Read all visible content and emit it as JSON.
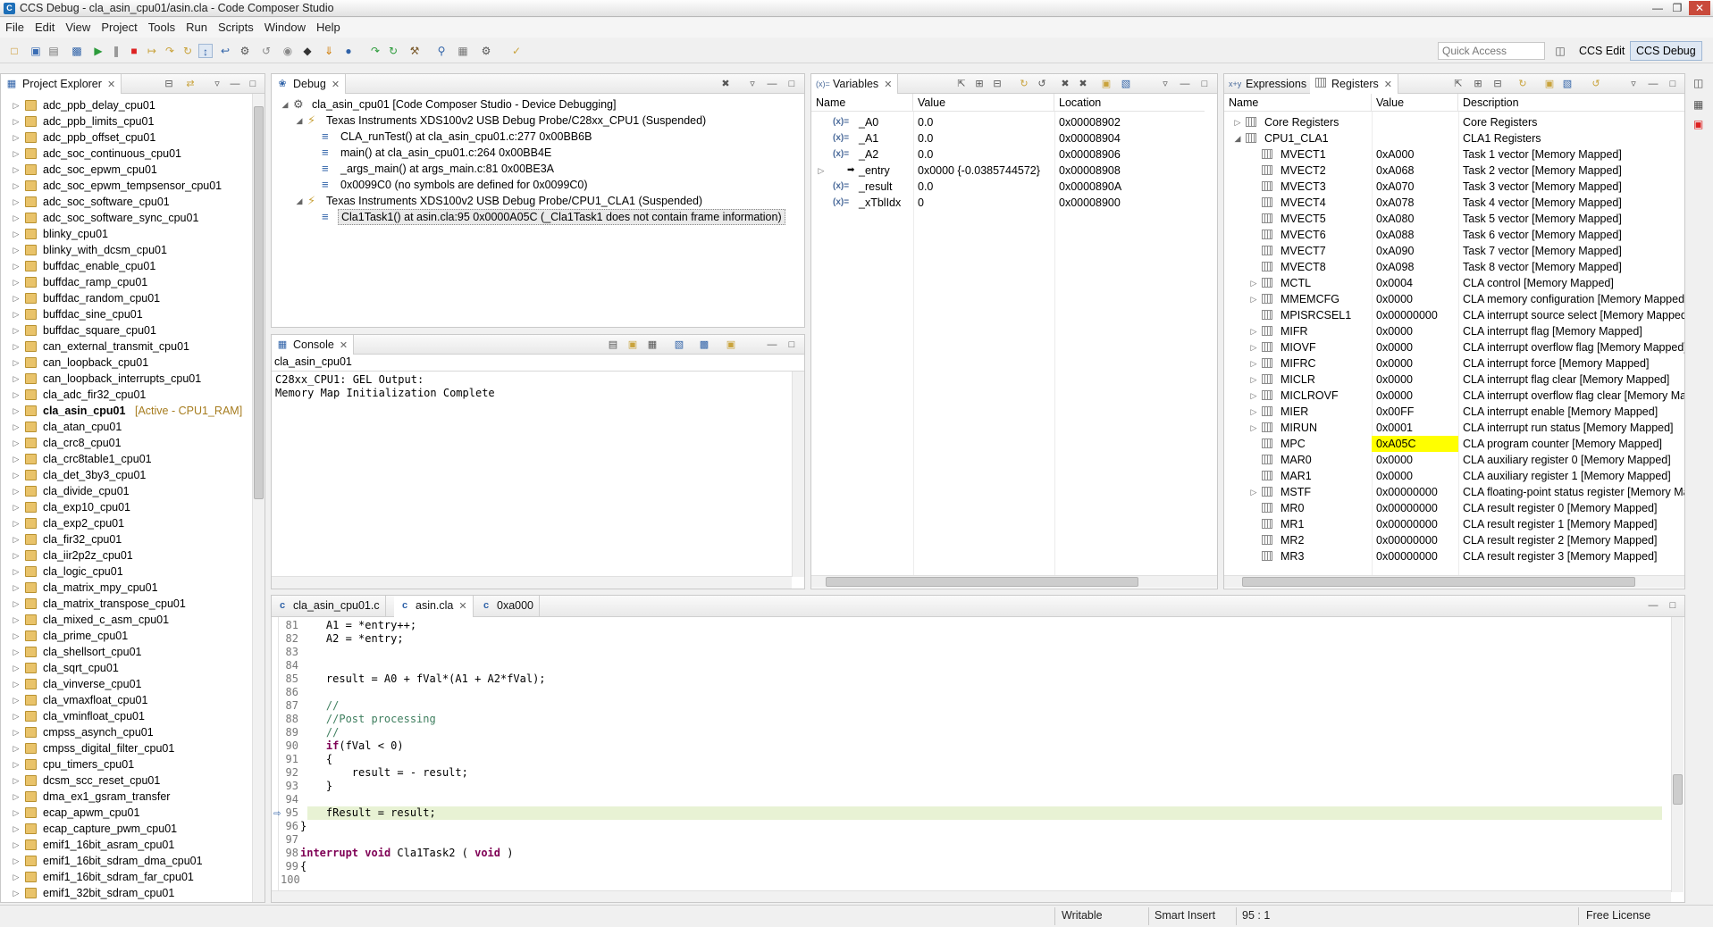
{
  "window": {
    "title": "CCS Debug - cla_asin_cpu01/asin.cla - Code Composer Studio"
  },
  "menu": [
    "File",
    "Edit",
    "View",
    "Project",
    "Tools",
    "Run",
    "Scripts",
    "Window",
    "Help"
  ],
  "toolbar": {
    "quick_access_placeholder": "Quick Access",
    "perspective_edit": "CCS Edit",
    "perspective_debug": "CCS Debug"
  },
  "project_explorer": {
    "title": "Project Explorer",
    "active_suffix": "[Active - CPU1_RAM]",
    "projects": [
      "adc_ppb_delay_cpu01",
      "adc_ppb_limits_cpu01",
      "adc_ppb_offset_cpu01",
      "adc_soc_continuous_cpu01",
      "adc_soc_epwm_cpu01",
      "adc_soc_epwm_tempsensor_cpu01",
      "adc_soc_software_cpu01",
      "adc_soc_software_sync_cpu01",
      "blinky_cpu01",
      "blinky_with_dcsm_cpu01",
      "buffdac_enable_cpu01",
      "buffdac_ramp_cpu01",
      "buffdac_random_cpu01",
      "buffdac_sine_cpu01",
      "buffdac_square_cpu01",
      "can_external_transmit_cpu01",
      "can_loopback_cpu01",
      "can_loopback_interrupts_cpu01",
      "cla_adc_fir32_cpu01",
      "cla_asin_cpu01",
      "cla_atan_cpu01",
      "cla_crc8_cpu01",
      "cla_crc8table1_cpu01",
      "cla_det_3by3_cpu01",
      "cla_divide_cpu01",
      "cla_exp10_cpu01",
      "cla_exp2_cpu01",
      "cla_fir32_cpu01",
      "cla_iir2p2z_cpu01",
      "cla_logic_cpu01",
      "cla_matrix_mpy_cpu01",
      "cla_matrix_transpose_cpu01",
      "cla_mixed_c_asm_cpu01",
      "cla_prime_cpu01",
      "cla_shellsort_cpu01",
      "cla_sqrt_cpu01",
      "cla_vinverse_cpu01",
      "cla_vmaxfloat_cpu01",
      "cla_vminfloat_cpu01",
      "cmpss_asynch_cpu01",
      "cmpss_digital_filter_cpu01",
      "cpu_timers_cpu01",
      "dcsm_scc_reset_cpu01",
      "dma_ex1_gsram_transfer",
      "ecap_apwm_cpu01",
      "ecap_capture_pwm_cpu01",
      "emif1_16bit_asram_cpu01",
      "emif1_16bit_sdram_dma_cpu01",
      "emif1_16bit_sdram_far_cpu01",
      "emif1_32bit_sdram_cpu01"
    ]
  },
  "debug": {
    "title": "Debug",
    "items": [
      "cla_asin_cpu01 [Code Composer Studio - Device Debugging]",
      "Texas Instruments XDS100v2 USB Debug Probe/C28xx_CPU1 (Suspended)",
      "CLA_runTest() at cla_asin_cpu01.c:277 0x00BB6B",
      "main() at cla_asin_cpu01.c:264 0x00BB4E",
      "_args_main() at args_main.c:81 0x00BE3A",
      "0x0099C0  (no symbols are defined for 0x0099C0)",
      "Texas Instruments XDS100v2 USB Debug Probe/CPU1_CLA1 (Suspended)",
      "Cla1Task1() at asin.cla:95 0x0000A05C  (_Cla1Task1 does not contain frame information)"
    ]
  },
  "console": {
    "title": "Console",
    "subtitle": "cla_asin_cpu01",
    "lines": [
      "C28xx_CPU1: GEL Output:",
      "Memory Map Initialization Complete"
    ]
  },
  "variables": {
    "title": "Variables",
    "columns": [
      "Name",
      "Value",
      "Location"
    ],
    "rows": [
      {
        "name": "_A0",
        "value": "0.0",
        "location": "0x00008902"
      },
      {
        "name": "_A1",
        "value": "0.0",
        "location": "0x00008904"
      },
      {
        "name": "_A2",
        "value": "0.0",
        "location": "0x00008906"
      },
      {
        "name": "_entry",
        "value": "0x0000 {-0.0385744572}",
        "location": "0x00008908"
      },
      {
        "name": "_result",
        "value": "0.0",
        "location": "0x0000890A"
      },
      {
        "name": "_xTblIdx",
        "value": "0",
        "location": "0x00008900"
      }
    ]
  },
  "registers": {
    "tab_expressions": "Expressions",
    "title": "Registers",
    "columns": [
      "Name",
      "Value",
      "Description"
    ],
    "rows": [
      {
        "name": "Core Registers",
        "value": "",
        "desc": "Core Registers"
      },
      {
        "name": "CPU1_CLA1",
        "value": "",
        "desc": "CLA1 Registers"
      },
      {
        "name": "MVECT1",
        "value": "0xA000",
        "desc": "Task 1 vector [Memory Mapped]"
      },
      {
        "name": "MVECT2",
        "value": "0xA068",
        "desc": "Task 2 vector [Memory Mapped]"
      },
      {
        "name": "MVECT3",
        "value": "0xA070",
        "desc": "Task 3 vector [Memory Mapped]"
      },
      {
        "name": "MVECT4",
        "value": "0xA078",
        "desc": "Task 4 vector [Memory Mapped]"
      },
      {
        "name": "MVECT5",
        "value": "0xA080",
        "desc": "Task 5 vector [Memory Mapped]"
      },
      {
        "name": "MVECT6",
        "value": "0xA088",
        "desc": "Task 6 vector [Memory Mapped]"
      },
      {
        "name": "MVECT7",
        "value": "0xA090",
        "desc": "Task 7 vector [Memory Mapped]"
      },
      {
        "name": "MVECT8",
        "value": "0xA098",
        "desc": "Task 8 vector [Memory Mapped]"
      },
      {
        "name": "MCTL",
        "value": "0x0004",
        "desc": "CLA control [Memory Mapped]"
      },
      {
        "name": "MMEMCFG",
        "value": "0x0000",
        "desc": "CLA memory configuration [Memory Mapped]"
      },
      {
        "name": "MPISRCSEL1",
        "value": "0x00000000",
        "desc": "CLA interrupt source select [Memory Mapped]"
      },
      {
        "name": "MIFR",
        "value": "0x0000",
        "desc": "CLA interrupt flag [Memory Mapped]"
      },
      {
        "name": "MIOVF",
        "value": "0x0000",
        "desc": "CLA interrupt overflow flag [Memory Mapped]"
      },
      {
        "name": "MIFRC",
        "value": "0x0000",
        "desc": "CLA interrupt force [Memory Mapped]"
      },
      {
        "name": "MICLR",
        "value": "0x0000",
        "desc": "CLA interrupt flag clear [Memory Mapped]"
      },
      {
        "name": "MICLROVF",
        "value": "0x0000",
        "desc": "CLA interrupt overflow flag clear [Memory Map"
      },
      {
        "name": "MIER",
        "value": "0x00FF",
        "desc": "CLA interrupt enable [Memory Mapped]"
      },
      {
        "name": "MIRUN",
        "value": "0x0001",
        "desc": "CLA interrupt run status [Memory Mapped]"
      },
      {
        "name": "MPC",
        "value": "0xA05C",
        "desc": "CLA program counter [Memory Mapped]"
      },
      {
        "name": "MAR0",
        "value": "0x0000",
        "desc": "CLA auxiliary register 0 [Memory Mapped]"
      },
      {
        "name": "MAR1",
        "value": "0x0000",
        "desc": "CLA auxiliary register 1 [Memory Mapped]"
      },
      {
        "name": "MSTF",
        "value": "0x00000000",
        "desc": "CLA floating-point status register [Memory Ma"
      },
      {
        "name": "MR0",
        "value": "0x00000000",
        "desc": "CLA result register 0 [Memory Mapped]"
      },
      {
        "name": "MR1",
        "value": "0x00000000",
        "desc": "CLA result register 1 [Memory Mapped]"
      },
      {
        "name": "MR2",
        "value": "0x00000000",
        "desc": "CLA result register 2 [Memory Mapped]"
      },
      {
        "name": "MR3",
        "value": "0x00000000",
        "desc": "CLA result register 3 [Memory Mapped]"
      }
    ],
    "highlight_color": "#ffff00"
  },
  "editor": {
    "tabs": [
      "cla_asin_cpu01.c",
      "asin.cla",
      "0xa000"
    ],
    "lines": [
      {
        "n": "81",
        "t": "    A1 = *entry++;"
      },
      {
        "n": "82",
        "t": "    A2 = *entry;"
      },
      {
        "n": "83",
        "t": ""
      },
      {
        "n": "84",
        "t": ""
      },
      {
        "n": "85",
        "t": "    result = A0 + fVal*(A1 + A2*fVal);"
      },
      {
        "n": "86",
        "t": ""
      },
      {
        "n": "87",
        "t": "    //"
      },
      {
        "n": "88",
        "t": "    //Post processing"
      },
      {
        "n": "89",
        "t": "    //"
      },
      {
        "n": "90",
        "t": "    if(fVal < 0)"
      },
      {
        "n": "91",
        "t": "    {"
      },
      {
        "n": "92",
        "t": "        result = - result;"
      },
      {
        "n": "93",
        "t": "    }"
      },
      {
        "n": "94",
        "t": ""
      },
      {
        "n": "95",
        "t": "    fResult = result;"
      },
      {
        "n": "96",
        "t": "}"
      },
      {
        "n": "97",
        "t": ""
      },
      {
        "n": "98",
        "t": "interrupt void Cla1Task2 ( void )"
      },
      {
        "n": "99",
        "t": "{"
      },
      {
        "n": "100",
        "t": ""
      }
    ],
    "current_line_color": "#e8f2d4"
  },
  "status": {
    "writable": "Writable",
    "insert": "Smart Insert",
    "position": "95 : 1",
    "license": "Free License"
  }
}
